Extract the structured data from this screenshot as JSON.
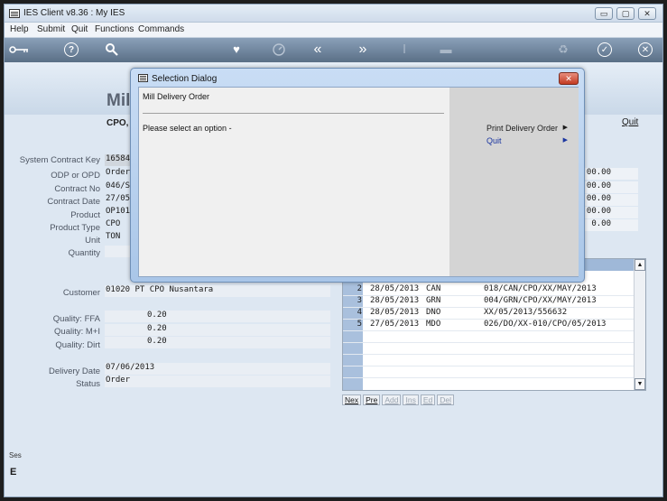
{
  "window": {
    "title": "IES Client v8.36 : My IES",
    "controls": [
      "▭",
      "▢",
      "✕"
    ]
  },
  "menu": [
    "Help",
    "Submit",
    "Quit",
    "Functions",
    "Commands"
  ],
  "toolbar": {
    "icons": [
      "key-icon",
      "help-icon",
      "search-icon",
      "heart-icon",
      "clock-icon",
      "rewind-icon",
      "fast-forward-icon",
      "text-cursor-icon",
      "clear-icon",
      "recycle-icon",
      "check-icon",
      "close-icon"
    ]
  },
  "form": {
    "title": "Mill",
    "subtitle": "CPO, I",
    "quit_label": "Quit"
  },
  "fields": [
    {
      "label": "System Contract Key",
      "value": "165848"
    },
    {
      "label": "ODP or OPD",
      "value": "Order"
    },
    {
      "label": "Contract No",
      "value": "046/SP"
    },
    {
      "label": "Contract Date",
      "value": "27/05/"
    },
    {
      "label": "Product",
      "value": "OP101"
    },
    {
      "label": "Product Type",
      "value": "CPO"
    },
    {
      "label": "Unit",
      "value": "TON"
    },
    {
      "label": "Quantity",
      "value": ""
    },
    {
      "label": "Customer",
      "value": "01020 PT CPO Nusantara"
    },
    {
      "label": "Quality: FFA",
      "value": "0.20"
    },
    {
      "label": "Quality: M+I",
      "value": "0.20"
    },
    {
      "label": "Quality: Dirt",
      "value": "0.20"
    },
    {
      "label": "Delivery Date",
      "value": "07/06/2013"
    },
    {
      "label": "Status",
      "value": "Order"
    }
  ],
  "right_values": [
    "00.00",
    "00.00",
    "00.00",
    "00.00",
    "0.00"
  ],
  "grid": {
    "rows": [
      {
        "num": "2",
        "date": "28/05/2013",
        "code": "CAN",
        "ref": "018/CAN/CPO/XX/MAY/2013"
      },
      {
        "num": "3",
        "date": "28/05/2013",
        "code": "GRN",
        "ref": "004/GRN/CPO/XX/MAY/2013"
      },
      {
        "num": "4",
        "date": "28/05/2013",
        "code": "DNO",
        "ref": "XX/05/2013/556632"
      },
      {
        "num": "5",
        "date": "27/05/2013",
        "code": "MDO",
        "ref": "026/DO/XX-010/CPO/05/2013"
      }
    ],
    "buttons": [
      "Nex",
      "Pre",
      "Add",
      "Ins",
      "Ed",
      "Del"
    ]
  },
  "session": {
    "label": "Ses",
    "glyph": "E"
  },
  "dialog": {
    "title": "Selection Dialog",
    "close_label": "✕",
    "heading": "Mill Delivery Order",
    "prompt": "Please select an option -",
    "options": [
      {
        "label": "Print Delivery Order",
        "arrow": "▶",
        "color": "#1a1a1a"
      },
      {
        "label": "Quit",
        "arrow": "▶",
        "color": "#1a35a0"
      }
    ]
  }
}
